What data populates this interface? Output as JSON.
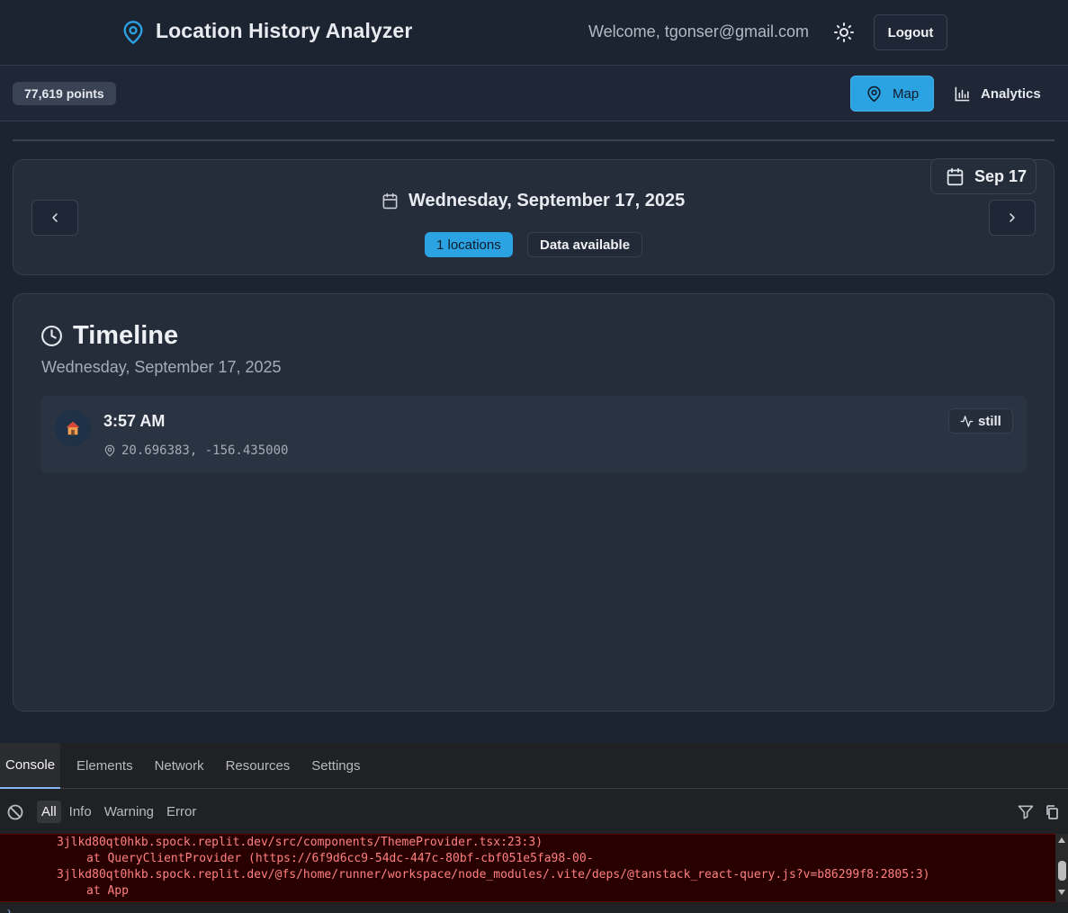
{
  "header": {
    "app_title": "Location History Analyzer",
    "welcome": "Welcome, tgonser@gmail.com",
    "logout_label": "Logout",
    "icons": [
      "map-pin-icon",
      "sun-icon"
    ]
  },
  "toolbar": {
    "points_badge": "77,619 points",
    "nav": [
      {
        "label": "Map",
        "icon": "map-pin-icon",
        "active": true
      },
      {
        "label": "Analytics",
        "icon": "bar-chart-icon",
        "active": false
      }
    ]
  },
  "date_card": {
    "picker_label": "Sep 17",
    "full_date": "Wednesday, September 17, 2025",
    "locations_badge": "1 locations",
    "data_badge": "Data available"
  },
  "timeline": {
    "title": "Timeline",
    "date": "Wednesday, September 17, 2025",
    "entries": [
      {
        "time": "3:57 AM",
        "coords": "20.696383, -156.435000",
        "activity": "still",
        "icon": "house-emoji-icon"
      }
    ]
  },
  "devtools": {
    "tabs": [
      "Console",
      "Elements",
      "Network",
      "Resources",
      "Settings"
    ],
    "active_tab": "Console",
    "levels": [
      "All",
      "Info",
      "Warning",
      "Error"
    ],
    "active_level": "All",
    "log_lines": [
      "3jlkd80qt0hkb.spock.replit.dev/src/components/ThemeProvider.tsx:23:3)",
      "at QueryClientProvider (https://6f9d6cc9-54dc-447c-80bf-cbf051e5fa98-00-",
      "3jlkd80qt0hkb.spock.replit.dev/@fs/home/runner/workspace/node_modules/.vite/deps/@tanstack_react-query.js?v=b86299f8:2805:3)",
      "at App"
    ]
  },
  "colors": {
    "background": "#1c2331",
    "card": "#252d3b",
    "accent": "#2ba3e2",
    "error_bg": "#290000",
    "error_text": "#ff8080"
  }
}
